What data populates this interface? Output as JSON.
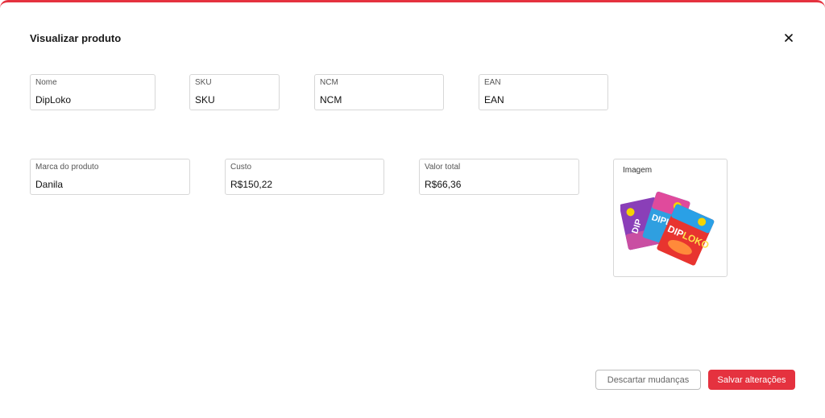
{
  "modal": {
    "title": "Visualizar produto",
    "close_icon": "close-icon",
    "accent_color": "#e5323f"
  },
  "fields": {
    "nome": {
      "label": "Nome",
      "value": "DipLoko"
    },
    "sku": {
      "label": "SKU",
      "value": "SKU"
    },
    "ncm": {
      "label": "NCM",
      "value": "NCM"
    },
    "ean": {
      "label": "EAN",
      "value": "EAN"
    },
    "marca": {
      "label": "Marca do produto",
      "value": "Danila"
    },
    "custo": {
      "label": "Custo",
      "value": "R$150,22"
    },
    "valor_total": {
      "label": "Valor total",
      "value": "R$66,36"
    }
  },
  "image": {
    "label": "Imagem",
    "brand_text": "DipLoko"
  },
  "actions": {
    "discard_label": "Descartar mudanças",
    "save_label": "Salvar alterações"
  }
}
